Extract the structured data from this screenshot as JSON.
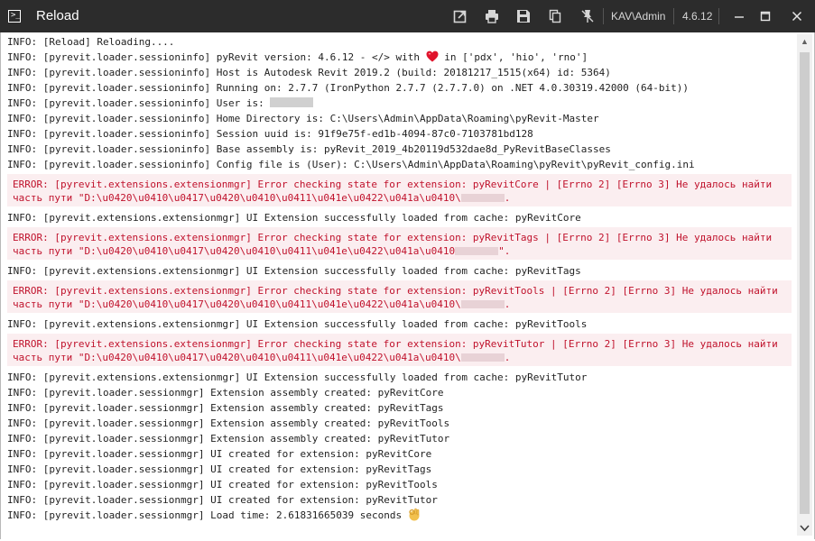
{
  "window": {
    "title": "Reload",
    "user": "KAV\\Admin",
    "version": "4.6.12"
  },
  "toolbar": {
    "icons": [
      "open-external-icon",
      "print-icon",
      "save-icon",
      "copy-icon",
      "pin-icon"
    ]
  },
  "log": {
    "pre_lines": [
      "INFO: [Reload] Reloading...."
    ],
    "version_line": {
      "before": "INFO: [pyrevit.loader.sessioninfo] pyRevit version: 4.6.12 - </> with ",
      "after": " in ['pdx', 'hio', 'rno']"
    },
    "session_lines": [
      "INFO: [pyrevit.loader.sessioninfo] Host is Autodesk Revit 2019.2 (build: 20181217_1515(x64) id: 5364)",
      "INFO: [pyrevit.loader.sessioninfo] Running on: 2.7.7 (IronPython 2.7.7 (2.7.7.0) on .NET 4.0.30319.42000 (64-bit))"
    ],
    "user_line": "INFO: [pyrevit.loader.sessioninfo] User is: ",
    "session_lines2": [
      "INFO: [pyrevit.loader.sessioninfo] Home Directory is: C:\\Users\\Admin\\AppData\\Roaming\\pyRevit-Master",
      "INFO: [pyrevit.loader.sessioninfo] Session uuid is: 91f9e75f-ed1b-4094-87c0-7103781bd128",
      "INFO: [pyrevit.loader.sessioninfo] Base assembly is: pyRevit_2019_4b20119d532dae8d_PyRevitBaseClasses",
      "INFO: [pyrevit.loader.sessioninfo] Config file is (User): C:\\Users\\Admin\\AppData\\Roaming\\pyRevit\\pyRevit_config.ini"
    ],
    "extensions": [
      {
        "error_line1": "ERROR: [pyrevit.extensions.extensionmgr] Error checking state for extension: pyRevitCore | [Errno 2] [Errno 3] Не удалось найти",
        "error_line2": "часть пути \"D:\\u0420\\u0410\\u0417\\u0420\\u0410\\u0411\\u041e\\u0422\\u041a\\u0410\\",
        "error_line2_end": ".",
        "loaded": "INFO: [pyrevit.extensions.extensionmgr] UI Extension successfully loaded from cache: pyRevitCore"
      },
      {
        "error_line1": "ERROR: [pyrevit.extensions.extensionmgr] Error checking state for extension: pyRevitTags | [Errno 2] [Errno 3] Не удалось найти",
        "error_line2": "часть пути \"D:\\u0420\\u0410\\u0417\\u0420\\u0410\\u0411\\u041e\\u0422\\u041a\\u0410",
        "error_line2_end": "\".",
        "loaded": "INFO: [pyrevit.extensions.extensionmgr] UI Extension successfully loaded from cache: pyRevitTags"
      },
      {
        "error_line1": "ERROR: [pyrevit.extensions.extensionmgr] Error checking state for extension: pyRevitTools | [Errno 2] [Errno 3] Не удалось найти",
        "error_line2": "часть пути \"D:\\u0420\\u0410\\u0417\\u0420\\u0410\\u0411\\u041e\\u0422\\u041a\\u0410\\",
        "error_line2_end": ".",
        "loaded": "INFO: [pyrevit.extensions.extensionmgr] UI Extension successfully loaded from cache: pyRevitTools"
      },
      {
        "error_line1": "ERROR: [pyrevit.extensions.extensionmgr] Error checking state for extension: pyRevitTutor | [Errno 2] [Errno 3] Не удалось найти",
        "error_line2": "часть пути \"D:\\u0420\\u0410\\u0417\\u0420\\u0410\\u0411\\u041e\\u0422\\u041a\\u0410\\",
        "error_line2_end": ".",
        "loaded": "INFO: [pyrevit.extensions.extensionmgr] UI Extension successfully loaded from cache: pyRevitTutor"
      }
    ],
    "post_lines": [
      "INFO: [pyrevit.loader.sessionmgr] Extension assembly created: pyRevitCore",
      "INFO: [pyrevit.loader.sessionmgr] Extension assembly created: pyRevitTags",
      "INFO: [pyrevit.loader.sessionmgr] Extension assembly created: pyRevitTools",
      "INFO: [pyrevit.loader.sessionmgr] Extension assembly created: pyRevitTutor",
      "INFO: [pyrevit.loader.sessionmgr] UI created for extension: pyRevitCore",
      "INFO: [pyrevit.loader.sessionmgr] UI created for extension: pyRevitTags",
      "INFO: [pyrevit.loader.sessionmgr] UI created for extension: pyRevitTools",
      "INFO: [pyrevit.loader.sessionmgr] UI created for extension: pyRevitTutor"
    ],
    "final_line": "INFO: [pyrevit.loader.sessionmgr] Load time: 2.61831665039 seconds "
  },
  "colors": {
    "titlebar": "#2c2c2c",
    "error_text": "#c0122c",
    "error_bg": "#fbeef0",
    "heart": "#e0142c"
  }
}
